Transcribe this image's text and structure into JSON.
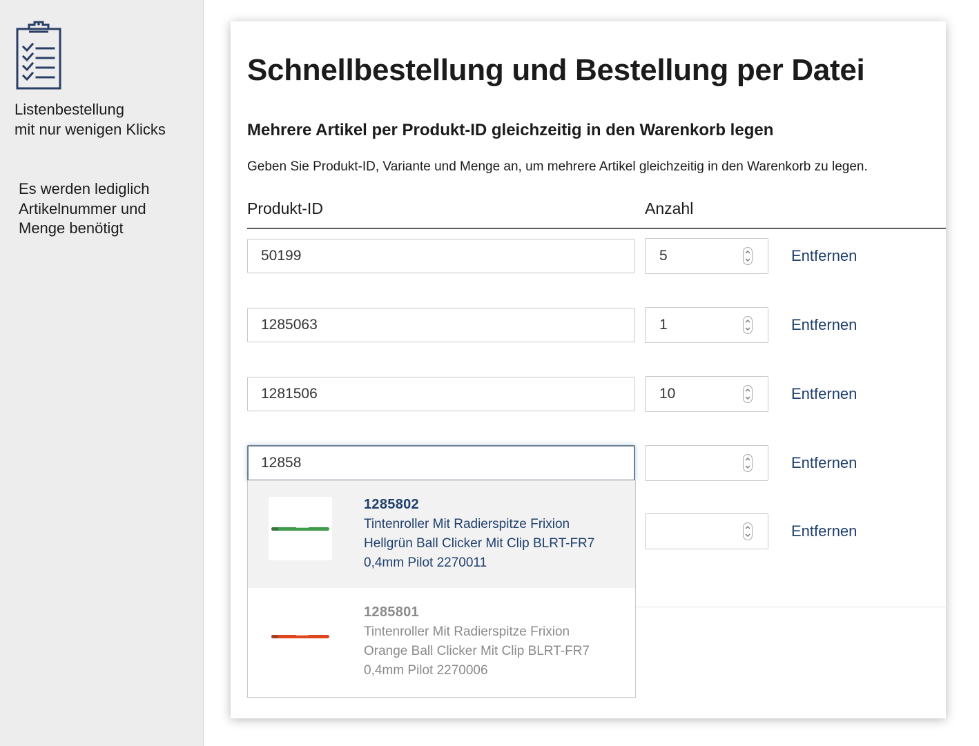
{
  "sidebar": {
    "feature1_line1": "Listenbestellung",
    "feature1_line2": "mit nur wenigen Klicks",
    "feature2_line1": "Es werden lediglich",
    "feature2_line2": "Artikelnummer und",
    "feature2_line3": "Menge benötigt",
    "icon": "clipboard-checklist-icon"
  },
  "page": {
    "title": "Schnellbestellung und Bestellung per Datei",
    "subtitle": "Mehrere Artikel per Produkt-ID gleichzeitig in den Warenkorb legen",
    "description": "Geben Sie Produkt-ID, Variante und Menge an, um mehrere Artikel gleichzeitig in den Warenkorb zu legen.",
    "col_product_id": "Produkt-ID",
    "col_quantity": "Anzahl"
  },
  "rows": [
    {
      "product_id": "50199",
      "quantity": "5",
      "remove_label": "Entfernen"
    },
    {
      "product_id": "1285063",
      "quantity": "1",
      "remove_label": "Entfernen"
    },
    {
      "product_id": "1281506",
      "quantity": "10",
      "remove_label": "Entfernen"
    },
    {
      "product_id": "12858",
      "quantity": "",
      "remove_label": "Entfernen"
    },
    {
      "product_id": "",
      "quantity": "",
      "remove_label": "Entfernen"
    }
  ],
  "suggestions": [
    {
      "id": "1285802",
      "line1": "Tintenroller Mit Radierspitze Frixion",
      "line2": "Hellgrün Ball Clicker Mit Clip BLRT-FR7",
      "line3": "0,4mm Pilot 2270011",
      "pen_color": "#3f9a4a"
    },
    {
      "id": "1285801",
      "line1": "Tintenroller Mit Radierspitze Frixion",
      "line2": "Orange Ball Clicker Mit Clip BLRT-FR7",
      "line3": "0,4mm Pilot 2270006",
      "pen_color": "#e0461e"
    }
  ],
  "colors": {
    "link": "#1f3f6c",
    "icon": "#2b3f66"
  }
}
